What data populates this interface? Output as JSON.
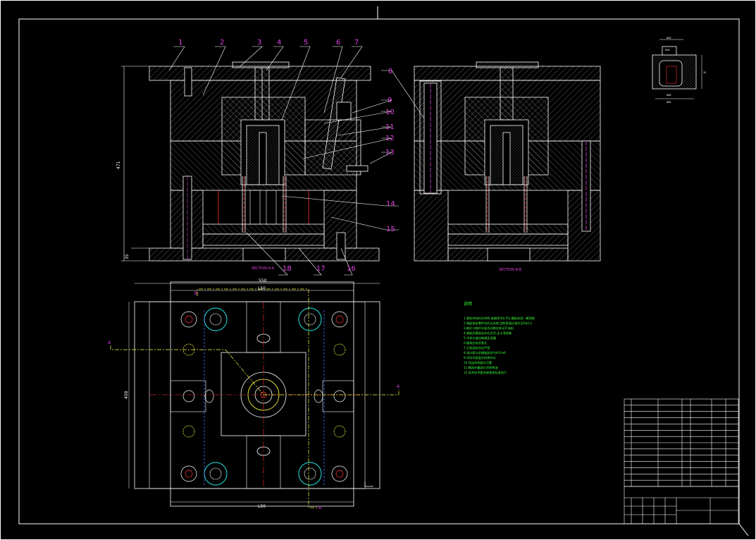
{
  "drawing": {
    "colors": {
      "background": "#000000",
      "outline": "#ffffff",
      "part_labels": "#e040e0",
      "centerlines": "#ff3030",
      "ejector_circles": "#20c0c0",
      "notes": "#39ff39",
      "runner": "#ffff40"
    },
    "section_aa": {
      "title": "SECTION A-A",
      "height_dim": "471",
      "small_dim": "35",
      "part_numbers": [
        "1",
        "2",
        "3",
        "4",
        "5",
        "6",
        "7",
        "8",
        "9",
        "10",
        "11",
        "12",
        "13",
        "14",
        "15",
        "16",
        "17",
        "18"
      ]
    },
    "section_bb": {
      "title": "SECTION B-B"
    },
    "plan_view": {
      "outer_width_dim": "550",
      "inner_width_top_dim": "L50",
      "inner_width_bottom_dim": "L50",
      "height_dim": "458",
      "section_marks": [
        "B",
        "B",
        "A",
        "A"
      ]
    },
    "part_detail": {
      "dim_top": "Φ50",
      "dim_mid": "Φ34",
      "dim_right": "30",
      "dim_bottom": "Φ60",
      "dim_base": "Φ64"
    },
    "notes": {
      "title": "说明",
      "lines": [
        "1.塑料件材料为ABS,收缩率为0.5%,模具采用一模两腔",
        "2.装配前各零件均应去毛刺,型腔表面应抛光至Ra0.2",
        "3.推杆与推杆孔配合间隙应保证不溢料",
        "4.装配后模具动作应灵活,无卡滞现象",
        "5.冷却水道应畅通无泄漏",
        "6.模具应有吊装孔",
        "7.分型面贴合应严密",
        "8.浇口套与定模板配合为H7/m6",
        "9.导柱导套配合间隙均匀",
        "10.顶出机构复位可靠",
        "11.模具外露部分涂防锈油",
        "12.其余技术要求按相关标准执行"
      ]
    },
    "title_block": {
      "rows": 14
    }
  }
}
